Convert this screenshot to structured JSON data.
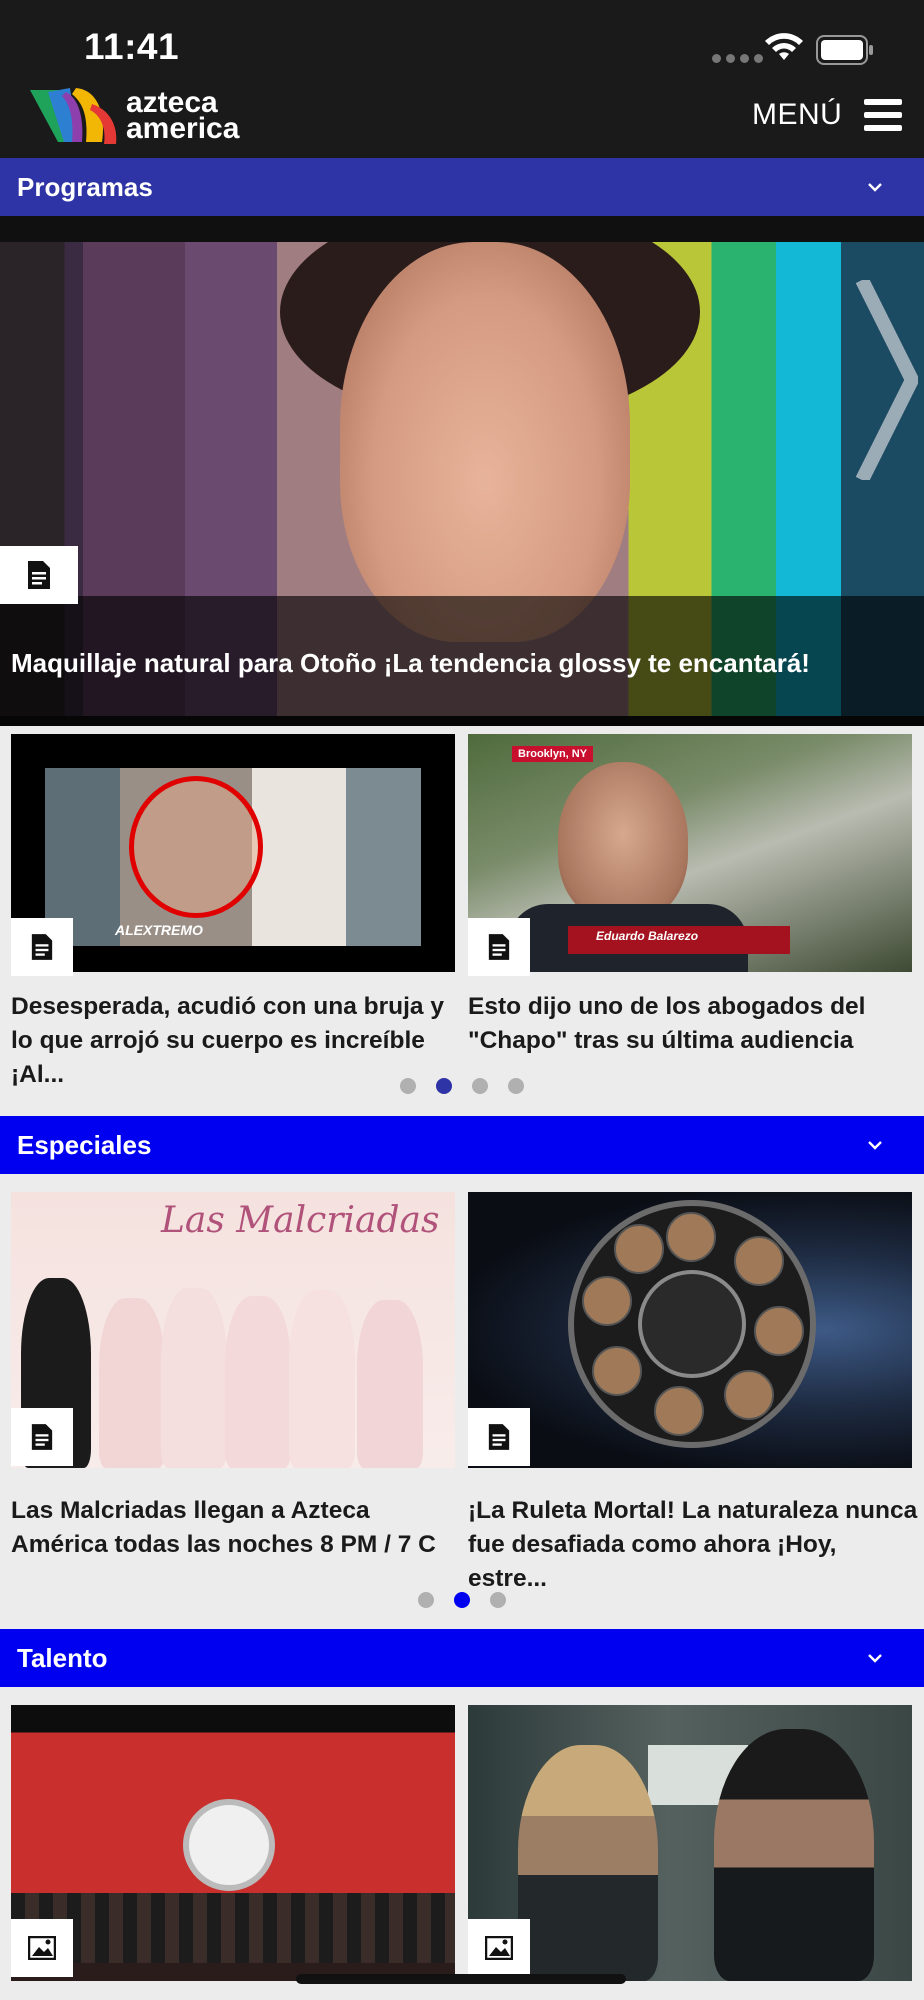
{
  "status_bar": {
    "time": "11:41"
  },
  "header": {
    "logo_line1": "azteca",
    "logo_line2": "america",
    "menu_label": "MENÚ"
  },
  "programas": {
    "title": "Programas",
    "hero": {
      "title": "Maquillaje natural para Otoño ¡La tendencia glossy te encantará!"
    },
    "cards": [
      {
        "title": "Desesperada, acudió con una bruja y lo que arrojó su cuerpo es increíble ¡Al...",
        "overlay": "ALEXTREMO"
      },
      {
        "title": "Esto dijo uno de los abogados del \"Chapo\" tras su última audiencia",
        "location": "Brooklyn, NY",
        "lower_third": "Eduardo Balarezo"
      }
    ],
    "pagination": {
      "total": 4,
      "active": 2
    }
  },
  "especiales": {
    "title": "Especiales",
    "cards": [
      {
        "title": "Las Malcriadas llegan a Azteca América todas las noches 8 PM / 7 C",
        "script": "Las Malcriadas"
      },
      {
        "title": "¡La Ruleta Mortal! La naturaleza nunca fue desafiada como ahora ¡Hoy, estre..."
      }
    ],
    "pagination": {
      "total": 3,
      "active": 2
    }
  },
  "talento": {
    "title": "Talento"
  },
  "colors": {
    "header_bg": "#1a1a1a",
    "programas_bar": "#2e33a5",
    "section_bar": "#0000f0",
    "page_bg": "#ececec"
  },
  "icons": [
    "wifi-icon",
    "battery-icon",
    "hamburger-menu-icon",
    "chevron-down-icon",
    "document-icon",
    "image-icon",
    "chevron-right-icon"
  ]
}
